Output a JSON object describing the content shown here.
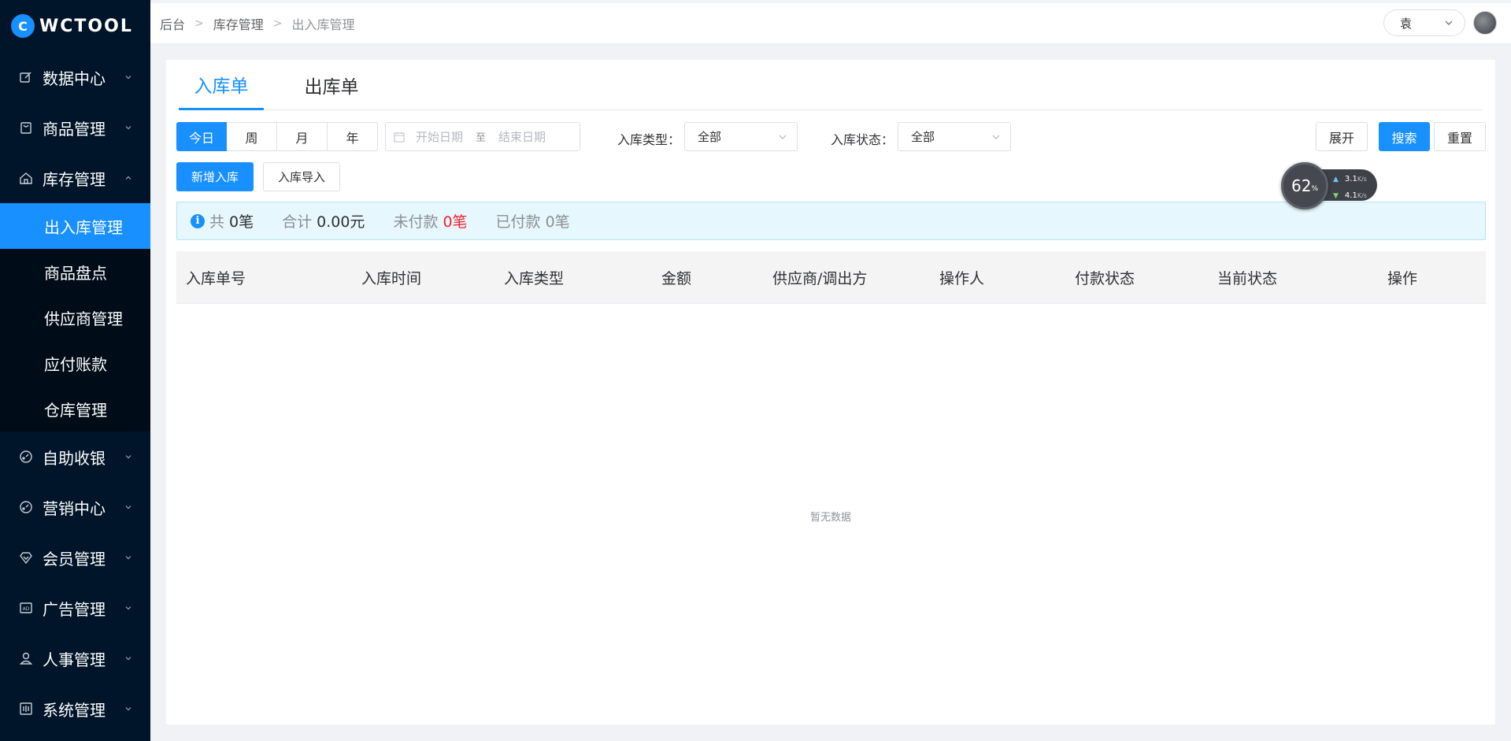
{
  "app": {
    "logo_text": "WCTOOL",
    "logo_badge": "C"
  },
  "sidebar": {
    "items": [
      {
        "label": "数据中心",
        "icon": "edit-icon"
      },
      {
        "label": "商品管理",
        "icon": "bag-icon"
      },
      {
        "label": "库存管理",
        "icon": "home-icon",
        "expanded": true
      }
    ],
    "sub_items": [
      {
        "label": "出入库管理",
        "active": true
      },
      {
        "label": "商品盘点"
      },
      {
        "label": "供应商管理"
      },
      {
        "label": "应付账款"
      },
      {
        "label": "仓库管理"
      }
    ],
    "items_after": [
      {
        "label": "自助收银",
        "icon": "gauge-icon"
      },
      {
        "label": "营销中心",
        "icon": "gauge-icon"
      },
      {
        "label": "会员管理",
        "icon": "diamond-icon"
      },
      {
        "label": "广告管理",
        "icon": "ad-icon"
      },
      {
        "label": "人事管理",
        "icon": "user-icon"
      },
      {
        "label": "系统管理",
        "icon": "grid-icon"
      }
    ]
  },
  "breadcrumb": [
    "后台",
    "库存管理",
    "出入库管理"
  ],
  "header": {
    "user_name": "袁"
  },
  "tabs": [
    "入库单",
    "出库单"
  ],
  "filters": {
    "periods": [
      "今日",
      "周",
      "月",
      "年"
    ],
    "date_start_placeholder": "开始日期",
    "date_to": "至",
    "date_end_placeholder": "结束日期",
    "type_label": "入库类型：",
    "type_value": "全部",
    "status_label": "入库状态：",
    "status_value": "全部",
    "expand_label": "展开",
    "search_label": "搜索",
    "reset_label": "重置"
  },
  "actions": {
    "add_label": "新增入库",
    "import_label": "入库导入"
  },
  "summary": {
    "total_label": "共",
    "total_value": "0笔",
    "sum_label": "合计",
    "sum_value": "0.00元",
    "unpaid_label": "未付款",
    "unpaid_value": "0笔",
    "paid_label": "已付款",
    "paid_value": "0笔"
  },
  "table": {
    "columns": [
      "入库单号",
      "入库时间",
      "入库类型",
      "金额",
      "供应商/调出方",
      "操作人",
      "付款状态",
      "当前状态",
      "操作"
    ],
    "empty_text": "暂无数据"
  },
  "speed_widget": {
    "percent": "62",
    "percent_unit": "%",
    "up": "3.1",
    "down": "4.1",
    "unit": "K/s"
  },
  "colors": {
    "primary": "#1890ff",
    "sidebar": "#001529",
    "danger": "#f5222d"
  }
}
